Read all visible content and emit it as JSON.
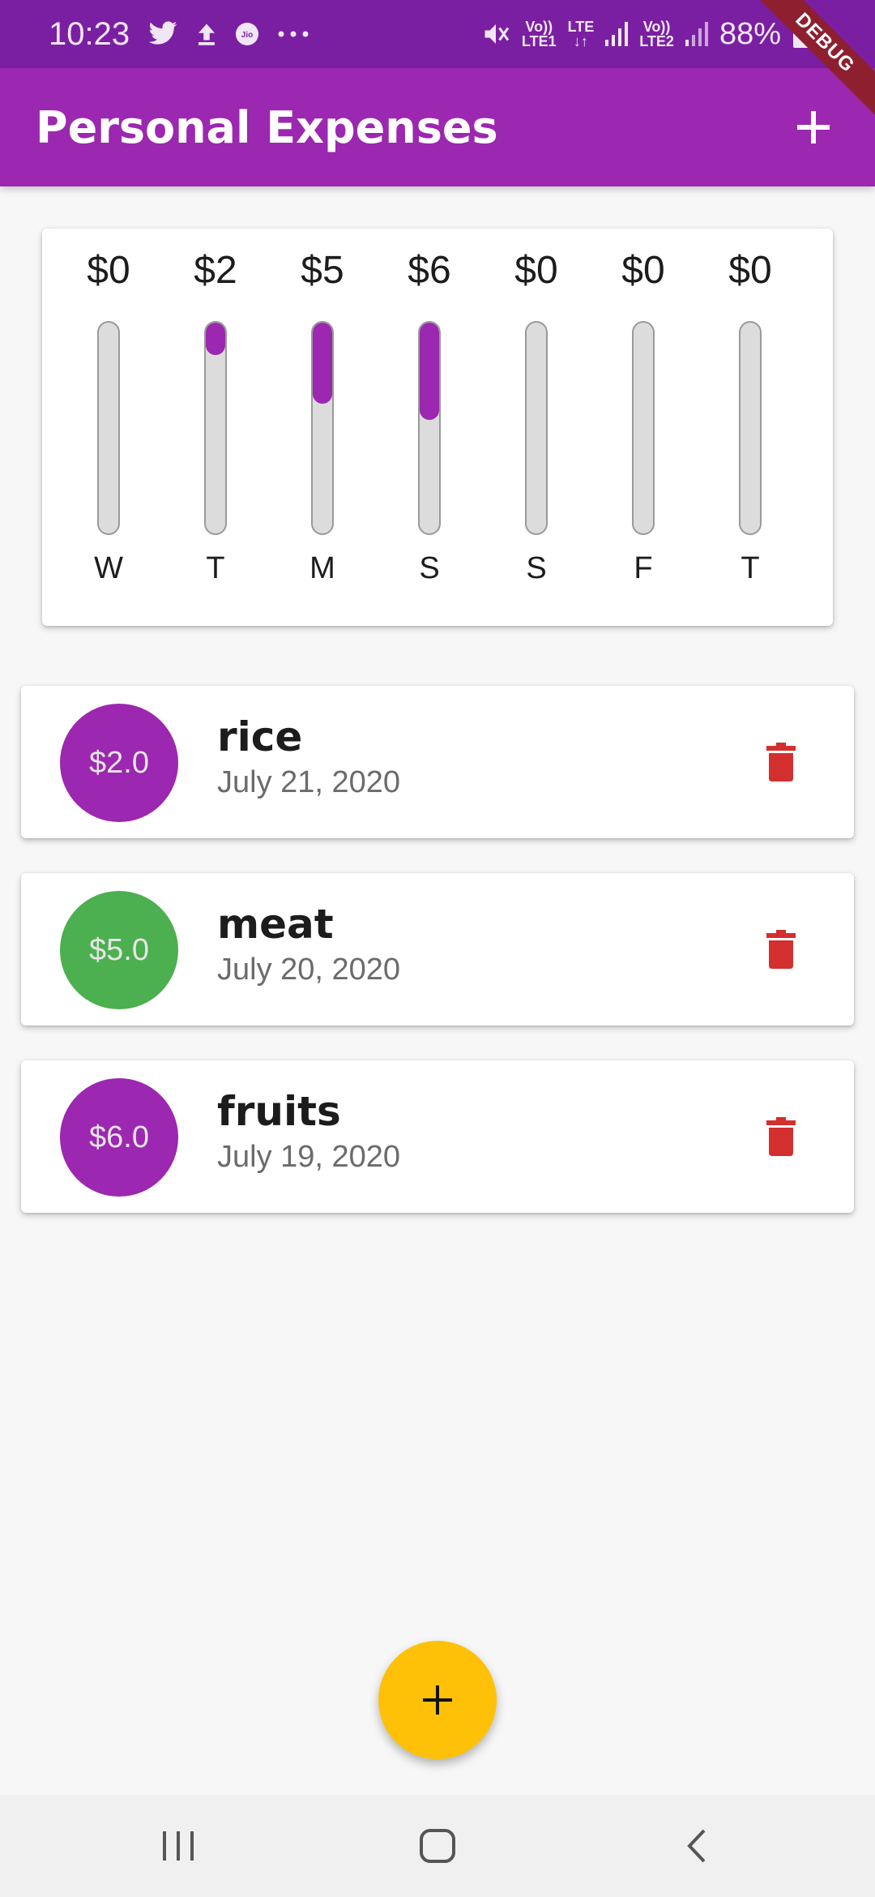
{
  "status_bar": {
    "time": "10:23",
    "left_icons": [
      "twitter-icon",
      "upload-icon",
      "jio-icon",
      "more-dots-icon"
    ],
    "network": [
      {
        "top": "Vo))",
        "bottom": "LTE1"
      },
      {
        "top": "LTE",
        "bottom": "↓↑"
      },
      {
        "top": "Vo))",
        "bottom": "LTE2"
      }
    ],
    "battery": "88%"
  },
  "debug_banner": "DEBUG",
  "app_bar": {
    "title": "Personal Expenses",
    "add_icon": "plus-icon"
  },
  "chart_data": {
    "type": "bar",
    "categories": [
      "W",
      "T",
      "M",
      "S",
      "S",
      "F",
      "T"
    ],
    "values": [
      0,
      2,
      5,
      6,
      0,
      0,
      0
    ],
    "amount_labels": [
      "$0",
      "$2",
      "$5",
      "$6",
      "$0",
      "$0",
      "$0"
    ],
    "fill_fraction": [
      0,
      0.1538,
      0.3846,
      0.4615,
      0,
      0,
      0
    ],
    "bar_color": "#9c27b0",
    "track_color": "#dcdcdc"
  },
  "transactions": [
    {
      "amount": "$2.0",
      "title": "rice",
      "date": "July 21, 2020",
      "color": "#9c27b0"
    },
    {
      "amount": "$5.0",
      "title": "meat",
      "date": "July 20, 2020",
      "color": "#4caf50"
    },
    {
      "amount": "$6.0",
      "title": "fruits",
      "date": "July 19, 2020",
      "color": "#9c27b0"
    }
  ],
  "delete_icon": "trash-icon",
  "delete_color": "#d32f2f",
  "fab": {
    "icon": "plus-icon",
    "color": "#ffc107"
  },
  "nav_bar": {
    "buttons": [
      "recent-apps-icon",
      "home-icon",
      "back-icon"
    ]
  }
}
